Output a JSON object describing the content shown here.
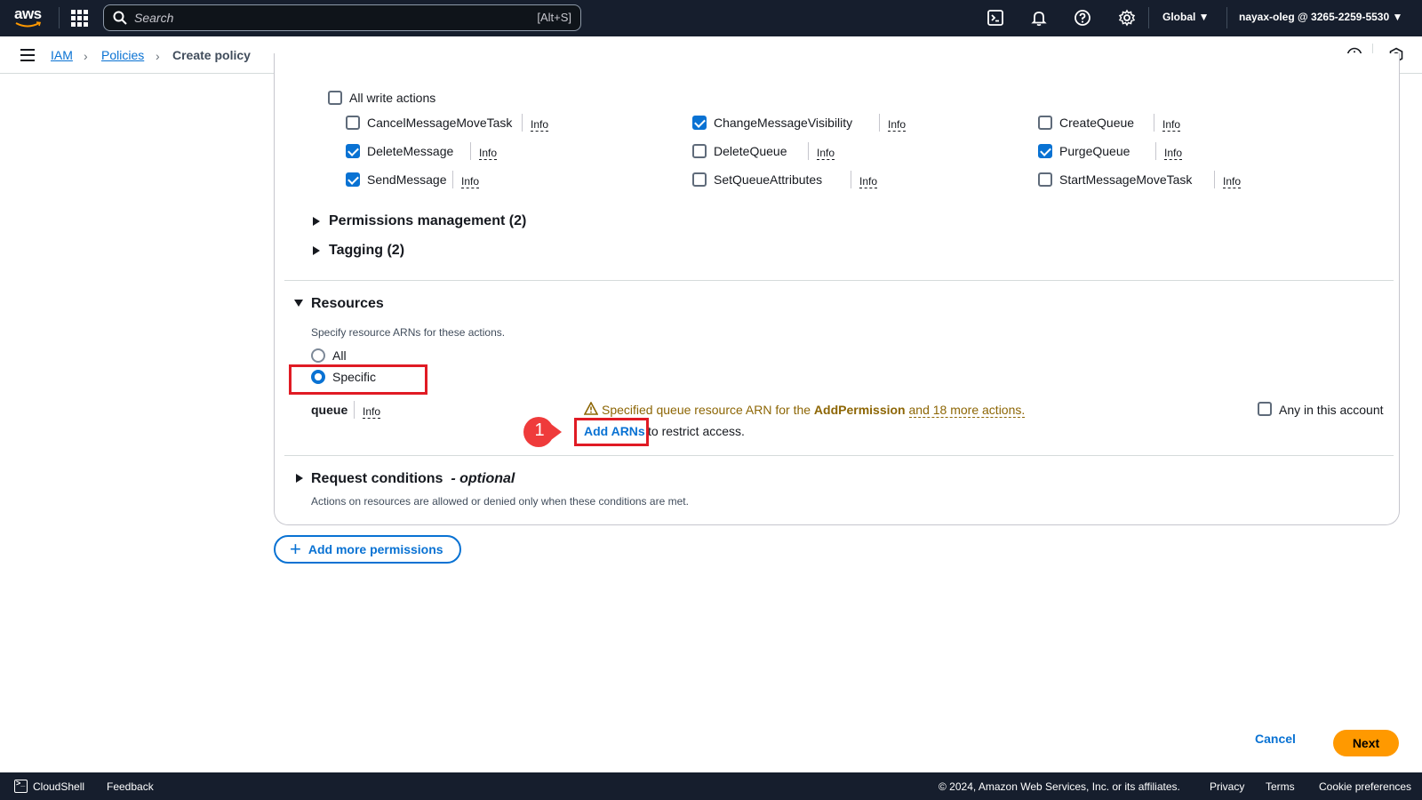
{
  "topnav": {
    "logo_text": "aws",
    "search_placeholder": "Search",
    "search_shortcut": "[Alt+S]",
    "region": "Global ▼",
    "account": "nayax-oleg @ 3265-2259-5530 ▼"
  },
  "breadcrumb": {
    "items": [
      "IAM",
      "Policies",
      "Create policy"
    ]
  },
  "write_actions": {
    "all_label": "All write actions",
    "all_checked": false,
    "info_label": "Info",
    "items": [
      {
        "label": "CancelMessageMoveTask",
        "checked": false
      },
      {
        "label": "ChangeMessageVisibility",
        "checked": true
      },
      {
        "label": "CreateQueue",
        "checked": false
      },
      {
        "label": "DeleteMessage",
        "checked": true
      },
      {
        "label": "DeleteQueue",
        "checked": false
      },
      {
        "label": "PurgeQueue",
        "checked": true
      },
      {
        "label": "SendMessage",
        "checked": true
      },
      {
        "label": "SetQueueAttributes",
        "checked": false
      },
      {
        "label": "StartMessageMoveTask",
        "checked": false
      }
    ]
  },
  "collapsed_groups": [
    "Permissions management (2)",
    "Tagging (2)"
  ],
  "resources": {
    "title": "Resources",
    "description": "Specify resource ARNs for these actions.",
    "option_all": "All",
    "option_specific": "Specific",
    "selected": "Specific",
    "queue_label": "queue",
    "info_label": "Info",
    "warning_prefix": "Specified queue resource ARN for the ",
    "warning_action": "AddPermission",
    "warning_more": "and 18 more actions.",
    "add_arns": "Add ARNs",
    "add_arns_suffix": "to restrict access.",
    "any_account": "Any in this account",
    "callout_number": "1"
  },
  "request_conditions": {
    "title": "Request conditions",
    "optional": "- optional",
    "description": "Actions on resources are allowed or denied only when these conditions are met."
  },
  "add_more_permissions": "Add more permissions",
  "actions": {
    "cancel": "Cancel",
    "next": "Next"
  },
  "footer": {
    "cloudshell": "CloudShell",
    "feedback": "Feedback",
    "copyright": "© 2024, Amazon Web Services, Inc. or its affiliates.",
    "privacy": "Privacy",
    "terms": "Terms",
    "cookies": "Cookie preferences"
  },
  "colors": {
    "accent": "#0972d3",
    "highlight": "#e01b24",
    "next": "#ff9900",
    "nav": "#161e2d"
  }
}
